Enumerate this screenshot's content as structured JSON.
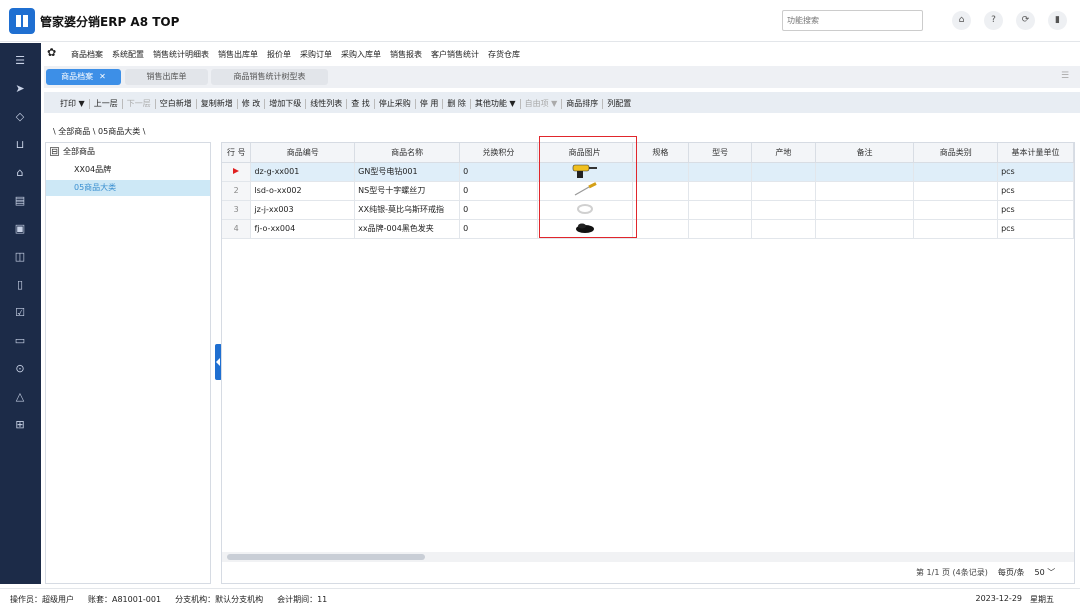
{
  "app": {
    "title": "管家婆分销ERP A8 TOP"
  },
  "header": {
    "search_placeholder": "功能搜索",
    "icons": [
      "home-icon",
      "help-icon",
      "refresh-icon",
      "battery-icon"
    ]
  },
  "nav_icons": [
    "menu-icon",
    "send-icon",
    "tag-icon",
    "cart-icon",
    "warehouse-icon",
    "report-icon",
    "inventory-icon",
    "chart-icon",
    "document-icon",
    "check-icon",
    "clipboard-icon",
    "settings-icon",
    "alert-icon",
    "grid-icon"
  ],
  "menu": {
    "items": [
      "商品档案",
      "系统配置",
      "销售统计明细表",
      "销售出库单",
      "报价单",
      "采购订单",
      "采购入库单",
      "销售报表",
      "客户销售统计",
      "存货仓库"
    ]
  },
  "tabs": [
    {
      "label": "商品档案",
      "active": true
    },
    {
      "label": "销售出库单",
      "active": false
    },
    {
      "label": "商品销售统计树型表",
      "active": false
    }
  ],
  "toolbar": {
    "items": [
      {
        "label": "打印 ▼",
        "disabled": false
      },
      {
        "label": "上一层",
        "disabled": false
      },
      {
        "label": "下一层",
        "disabled": true
      },
      {
        "label": "空白新增",
        "disabled": false
      },
      {
        "label": "复制新增",
        "disabled": false
      },
      {
        "label": "修 改",
        "disabled": false
      },
      {
        "label": "增加下级",
        "disabled": false
      },
      {
        "label": "线性列表",
        "disabled": false
      },
      {
        "label": "查 找",
        "disabled": false
      },
      {
        "label": "停止采购",
        "disabled": false
      },
      {
        "label": "停 用",
        "disabled": false
      },
      {
        "label": "删 除",
        "disabled": false
      },
      {
        "label": "其他功能 ▼",
        "disabled": false
      },
      {
        "label": "自由项 ▼",
        "disabled": true
      },
      {
        "label": "商品排序",
        "disabled": false
      },
      {
        "label": "列配置",
        "disabled": false
      }
    ]
  },
  "breadcrumb": "\\ 全部商品 \\ 05商品大类 \\",
  "tree": {
    "root": "全部商品",
    "root_toggle": "⊟",
    "nodes": [
      {
        "label": "XX04品牌",
        "selected": false
      },
      {
        "label": "05商品大类",
        "selected": true
      }
    ]
  },
  "grid": {
    "columns": [
      "行 号",
      "商品编号",
      "商品名称",
      "兑换积分",
      "商品图片",
      "规格",
      "型号",
      "产地",
      "备注",
      "商品类别",
      "基本计量单位"
    ],
    "rows": [
      {
        "rownum": "",
        "code": "dz-g-xx001",
        "name": "GN型号电钻001",
        "points": "0",
        "image": "drill-image",
        "unit": "pcs"
      },
      {
        "rownum": "2",
        "code": "lsd-o-xx002",
        "name": "NS型号十字螺丝刀",
        "points": "0",
        "image": "screwdriver-image",
        "unit": "pcs"
      },
      {
        "rownum": "3",
        "code": "jz-j-xx003",
        "name": "XX纯银-莫比乌斯环戒指",
        "points": "0",
        "image": "ring-image",
        "unit": "pcs"
      },
      {
        "rownum": "4",
        "code": "fj-o-xx004",
        "name": "xx品牌-004黑色发夹",
        "points": "0",
        "image": "hairclip-image",
        "unit": "pcs"
      }
    ]
  },
  "pager": {
    "info": "第 1/1 页 (4条记录)",
    "per_page_label": "每页/条",
    "per_page_value": "50 ﹀"
  },
  "status": {
    "operator": "操作员：超级用户",
    "account": "账套：A81001-001",
    "branch": "分支机构：默认分支机构",
    "period": "会计期间：11",
    "date": "2023-12-29",
    "weekday": "星期五"
  },
  "colors": {
    "brand": "#1f6fd1",
    "nav_bg": "#1c2b48",
    "highlight": "#e0262c",
    "active_tab": "#3d8fe7"
  }
}
